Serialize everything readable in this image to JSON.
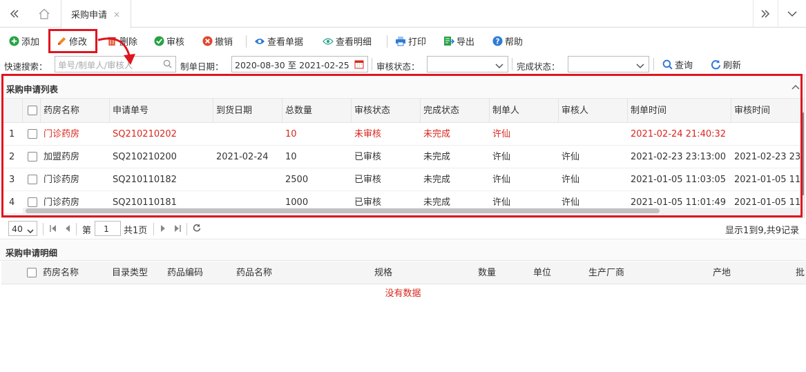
{
  "window": {
    "tab_label": "采购申请",
    "tab_close": "×"
  },
  "toolbar": {
    "add": "添加",
    "edit": "修改",
    "delete": "删除",
    "audit": "审核",
    "revoke": "撤销",
    "view_doc": "查看单据",
    "view_detail": "查看明细",
    "print": "打印",
    "export": "导出",
    "help": "帮助"
  },
  "search": {
    "quick_label": "快速搜索：",
    "quick_placeholder": "单号/制单人/审核人",
    "date_label": "制单日期：",
    "date_value": "2020-08-30 至 2021-02-25",
    "audit_label": "审核状态：",
    "audit_value": "",
    "complete_label": "完成状态：",
    "complete_value": "",
    "query": "查询",
    "refresh": "刷新"
  },
  "list": {
    "title": "采购申请列表",
    "columns": [
      "药房名称",
      "申请单号",
      "到货日期",
      "总数量",
      "审核状态",
      "完成状态",
      "制单人",
      "审核人",
      "制单时间",
      "审核时间"
    ],
    "rows": [
      {
        "no": "1",
        "pharmacy": "门诊药房",
        "code": "SQ210210202",
        "arrival": "",
        "qty": "10",
        "audit": "未审核",
        "done": "未完成",
        "maker": "许仙",
        "auditor": "",
        "made_at": "2021-02-24 21:40:32",
        "audited_at": "",
        "highlight": true
      },
      {
        "no": "2",
        "pharmacy": "加盟药房",
        "code": "SQ210210200",
        "arrival": "2021-02-24",
        "qty": "10",
        "audit": "已审核",
        "done": "未完成",
        "maker": "许仙",
        "auditor": "许仙",
        "made_at": "2021-02-23 23:13:00",
        "audited_at": "2021-02-23 23:1",
        "highlight": false
      },
      {
        "no": "3",
        "pharmacy": "门诊药房",
        "code": "SQ210110182",
        "arrival": "",
        "qty": "2500",
        "audit": "已审核",
        "done": "未完成",
        "maker": "许仙",
        "auditor": "许仙",
        "made_at": "2021-01-05 11:03:05",
        "audited_at": "2021-01-05 11:",
        "highlight": false
      },
      {
        "no": "4",
        "pharmacy": "门诊药房",
        "code": "SQ210110181",
        "arrival": "",
        "qty": "1000",
        "audit": "已审核",
        "done": "未完成",
        "maker": "许仙",
        "auditor": "许仙",
        "made_at": "2021-01-05 11:01:49",
        "audited_at": "2021-01-05 11:",
        "highlight": false
      }
    ]
  },
  "pager": {
    "page_size": "40",
    "page_label": "第",
    "page_value": "1",
    "total_pages": "共1页",
    "summary": "显示1到9,共9记录"
  },
  "detail": {
    "title": "采购申请明细",
    "columns": [
      "药房名称",
      "目录类型",
      "药品编码",
      "药品名称",
      "规格",
      "数量",
      "单位",
      "生产厂商",
      "产地",
      "批"
    ],
    "empty": "没有数据"
  },
  "colors": {
    "highlight_red": "#d9261c",
    "annotation_red": "#e0141e",
    "add_green": "#27a243",
    "help_blue": "#2f7bd6"
  }
}
